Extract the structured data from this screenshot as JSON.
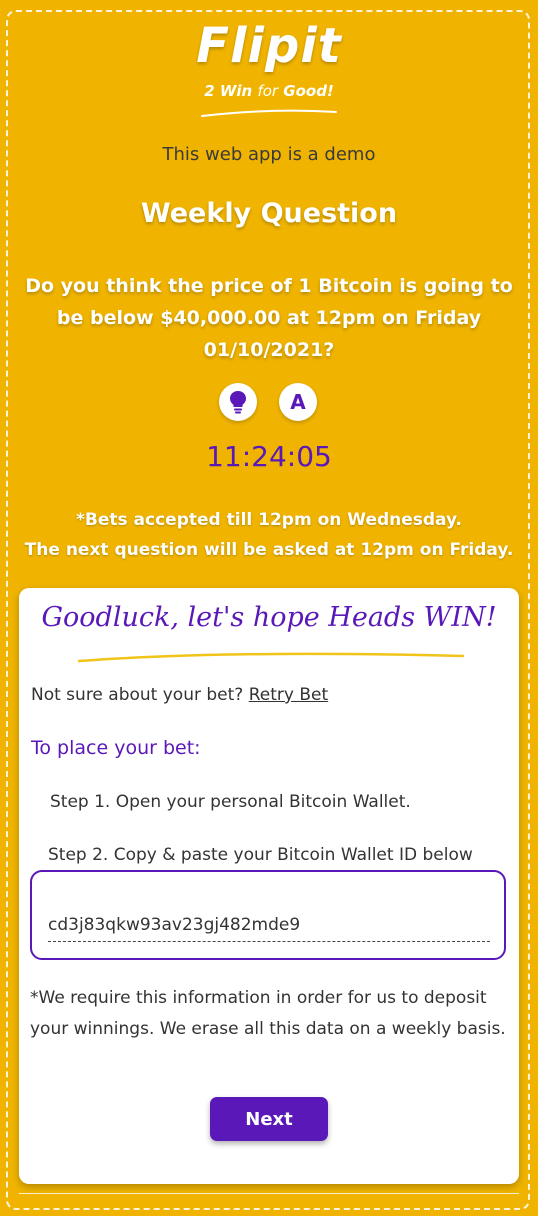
{
  "brand": {
    "title": "Flipit",
    "tagline_prefix": "2 Win ",
    "tagline_for": "for",
    "tagline_suffix": " Good!"
  },
  "demo_notice": "This web app is a demo",
  "weekly": {
    "title": "Weekly Question",
    "question": "Do you think the price of 1 Bitcoin is going to be below $40,000.00 at 12pm on Friday 01/10/2021?",
    "icon_a_label": "A",
    "timer": "11:24:05",
    "note_line1": "*Bets accepted till 12pm on Wednesday.",
    "note_line2": "The next question will be asked at 12pm on Friday."
  },
  "card": {
    "goodluck": "Goodluck, let's hope Heads WIN!",
    "retry_prompt": "Not sure about your bet? ",
    "retry_link": "Retry Bet",
    "place_title": "To place your bet:",
    "step1": "Step 1. Open your personal Bitcoin Wallet.",
    "step2": "Step 2. Copy & paste your Bitcoin Wallet ID below",
    "wallet_value": "cd3j83qkw93av23gj482mde9",
    "disclaimer": "*We require this information in order for us to deposit your winnings. We erase all this data on a weekly basis.",
    "next_label": "Next"
  },
  "icons": [
    "lightbulb-icon",
    "a-icon"
  ],
  "colors": {
    "background": "#f0b400",
    "accent": "#5a18b8",
    "card": "#ffffff"
  }
}
